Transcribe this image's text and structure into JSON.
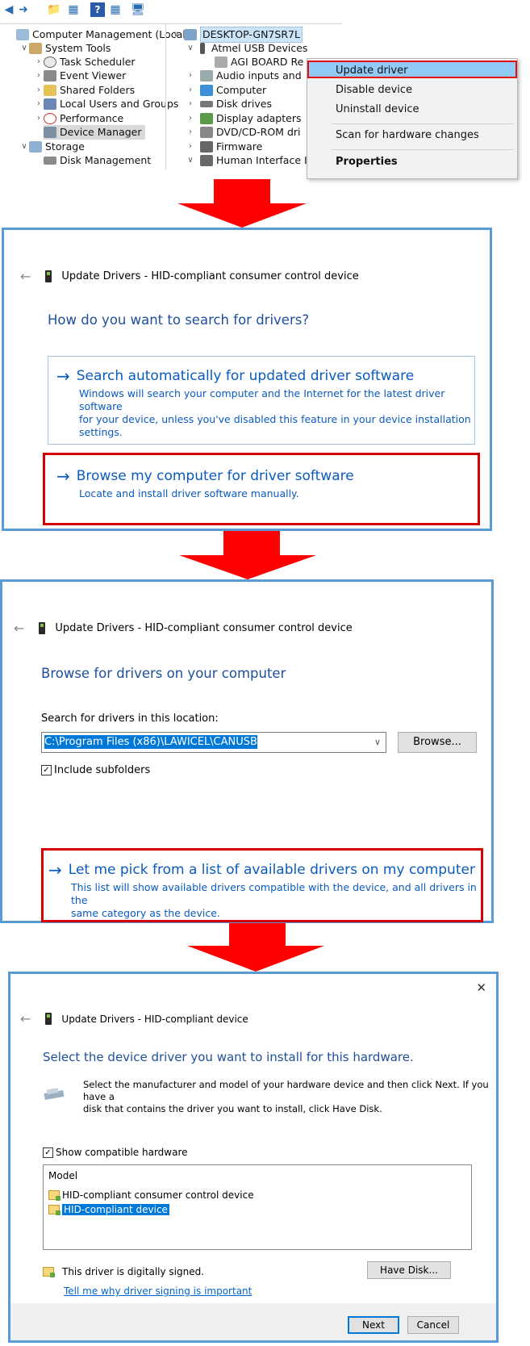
{
  "panel1": {
    "tree_left": [
      {
        "label": "Computer Management (Local"
      },
      {
        "label": "System Tools"
      },
      {
        "label": "Task Scheduler"
      },
      {
        "label": "Event Viewer"
      },
      {
        "label": "Shared Folders"
      },
      {
        "label": "Local Users and Groups"
      },
      {
        "label": "Performance"
      },
      {
        "label": "Device Manager"
      },
      {
        "label": "Storage"
      },
      {
        "label": "Disk Management"
      }
    ],
    "tree_right": [
      {
        "label": "DESKTOP-GN7SR7L"
      },
      {
        "label": "Atmel USB Devices"
      },
      {
        "label": "AGI BOARD Re"
      },
      {
        "label": "Audio inputs and"
      },
      {
        "label": "Computer"
      },
      {
        "label": "Disk drives"
      },
      {
        "label": "Display adapters"
      },
      {
        "label": "DVD/CD-ROM dri"
      },
      {
        "label": "Firmware"
      },
      {
        "label": "Human Interface I"
      }
    ],
    "context_menu": {
      "update": "Update driver",
      "disable": "Disable device",
      "uninstall": "Uninstall device",
      "scan": "Scan for hardware changes",
      "properties": "Properties"
    }
  },
  "panel2": {
    "header": "Update Drivers - HID-compliant consumer control device",
    "title": "How do you want to search for drivers?",
    "auto_title": "Search automatically for updated driver software",
    "auto_desc_1": "Windows will search your computer and the Internet for the latest driver software",
    "auto_desc_2": "for your device, unless you've disabled this feature in your device installation",
    "auto_desc_3": "settings.",
    "browse_title": "Browse my computer for driver software",
    "browse_desc": "Locate and install driver software manually."
  },
  "panel3": {
    "header": "Update Drivers - HID-compliant consumer control device",
    "title": "Browse for drivers on your computer",
    "search_label": "Search for drivers in this location:",
    "path_value": "C:\\Program Files (x86)\\LAWICEL\\CANUSB",
    "browse_button": "Browse...",
    "include_subfolders": "Include subfolders",
    "pick_title": "Let me pick from a list of available drivers on my computer",
    "pick_desc_1": "This list will show available drivers compatible with the device, and all drivers in the",
    "pick_desc_2": "same category as the device."
  },
  "panel4": {
    "close": "✕",
    "header": "Update Drivers - HID-compliant device",
    "title": "Select the device driver you want to install for this hardware.",
    "desc_1": "Select the manufacturer and model of your hardware device and then click Next. If you have a",
    "desc_2": "disk that contains the driver you want to install, click Have Disk.",
    "show_compatible": "Show compatible hardware",
    "model_header": "Model",
    "models": [
      {
        "label": "HID-compliant consumer control device"
      },
      {
        "label": "HID-compliant device"
      }
    ],
    "signed_text": "This driver is digitally signed.",
    "signing_link": "Tell me why driver signing is important",
    "have_disk": "Have Disk...",
    "next": "Next",
    "cancel": "Cancel"
  },
  "colors": {
    "arrow_red": "#ff0000",
    "highlight_red": "#d40000",
    "panel_blue": "#5b9bd5",
    "link_blue": "#0a5bbf",
    "selection_blue": "#0078d7"
  }
}
